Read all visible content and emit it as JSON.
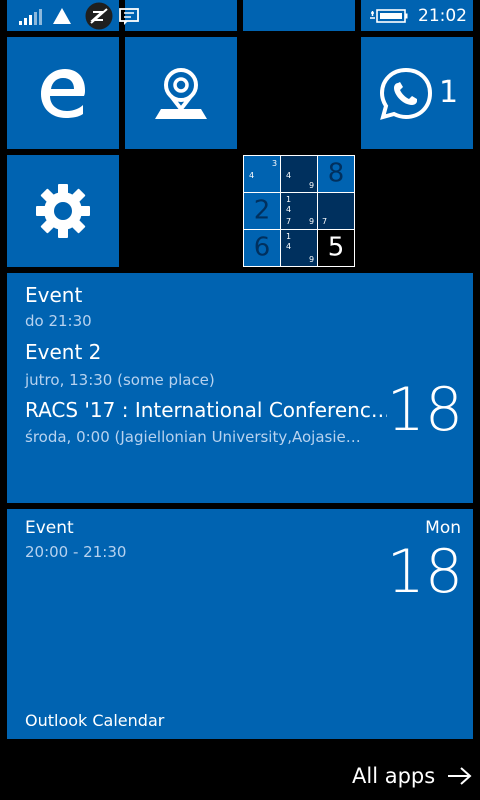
{
  "status_bar": {
    "time": "21:02",
    "icons": [
      "signal-icon",
      "wifi-icon",
      "quiet-hours-icon",
      "message-icon",
      "battery-charging-icon"
    ]
  },
  "tiles": {
    "edge": {
      "icon": "edge-icon"
    },
    "maps": {
      "icon": "map-pin-icon"
    },
    "whatsapp": {
      "icon": "whatsapp-icon",
      "badge": "1"
    },
    "settings": {
      "icon": "gear-icon"
    },
    "sudoku": {
      "cells": [
        {
          "notes": [
            "4",
            "3"
          ],
          "big": ""
        },
        {
          "notes": [
            "4",
            "9"
          ],
          "big": ""
        },
        {
          "notes": [],
          "big": "8"
        },
        {
          "notes": [],
          "big": "2"
        },
        {
          "notes": [
            "1",
            "4",
            "7",
            "9"
          ],
          "big": ""
        },
        {
          "notes": [
            "7"
          ],
          "big": ""
        },
        {
          "notes": [],
          "big": "6"
        },
        {
          "notes": [
            "1",
            "4",
            "9"
          ],
          "big": ""
        },
        {
          "notes": [],
          "big": "5"
        }
      ]
    }
  },
  "calendar_wide": {
    "events": [
      {
        "title": "Event",
        "detail": "do 21:30"
      },
      {
        "title": "Event 2",
        "detail": "jutro, 13:30  (some place)"
      },
      {
        "title": "RACS '17 : International Conferenc…",
        "detail": "środa, 0:00  (Jagiellonian University,Aojasie…"
      }
    ],
    "day_number": "18"
  },
  "outlook_calendar": {
    "event_title": "Event",
    "event_time": "20:00 - 21:30",
    "weekday": "Mon",
    "day_number": "18",
    "app_name": "Outlook Calendar"
  },
  "all_apps": {
    "label": "All apps",
    "icon": "arrow-right-icon"
  },
  "colors": {
    "tile": "#0063B1",
    "background": "#000000",
    "subtext": "#B7D2EF"
  }
}
